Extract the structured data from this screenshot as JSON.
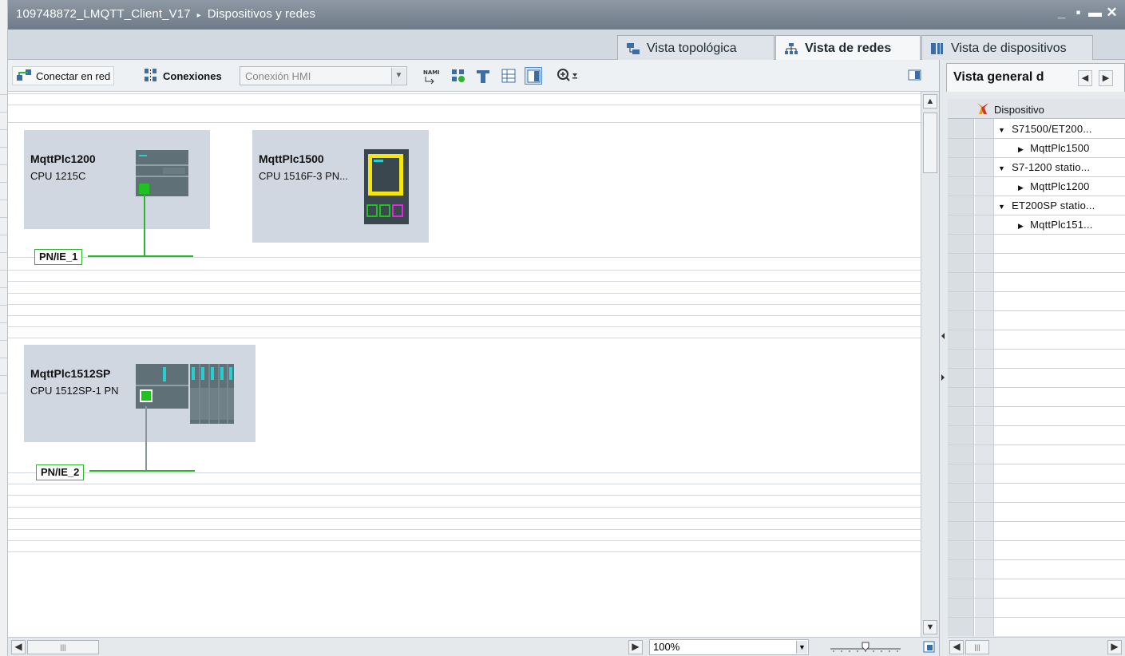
{
  "window": {
    "project": "109748872_LMQTT_Client_V17",
    "breadcrumb_sep": "▸",
    "section": "Dispositivos y redes",
    "controls": [
      "_",
      "▪",
      "▬",
      "✕"
    ]
  },
  "view_tabs": [
    {
      "label": "Vista topológica",
      "icon": "topology-icon",
      "active": false
    },
    {
      "label": "Vista de redes",
      "icon": "network-icon",
      "active": true
    },
    {
      "label": "Vista de dispositivos",
      "icon": "device-icon",
      "active": false
    }
  ],
  "toolbar": {
    "connect_label": "Conectar en red",
    "connections_label": "Conexiones",
    "connection_type": "Conexión HMI"
  },
  "devices": [
    {
      "name": "MqttPlc1200",
      "type": "CPU 1215C"
    },
    {
      "name": "MqttPlc1500",
      "type": "CPU 1516F-3 PN..."
    },
    {
      "name": "MqttPlc1512SP",
      "type": "CPU 1512SP-1 PN"
    }
  ],
  "subnets": [
    "PN/IE_1",
    "PN/IE_2"
  ],
  "status": {
    "zoom": "100%"
  },
  "overview": {
    "tab_label": "Vista general d",
    "column_header": "Dispositivo",
    "items": [
      {
        "label": "S71500/ET200...",
        "level": 0,
        "expanded": true
      },
      {
        "label": "MqttPlc1500",
        "level": 1,
        "expanded": false
      },
      {
        "label": "S7-1200 statio...",
        "level": 0,
        "expanded": true
      },
      {
        "label": "MqttPlc1200",
        "level": 1,
        "expanded": false
      },
      {
        "label": "ET200SP statio...",
        "level": 0,
        "expanded": true
      },
      {
        "label": "MqttPlc151...",
        "level": 1,
        "expanded": false
      }
    ]
  },
  "colors": {
    "profinet_line": "#2db52d",
    "device_box": "#d1d7e0",
    "title_bar": "#7d8996"
  }
}
